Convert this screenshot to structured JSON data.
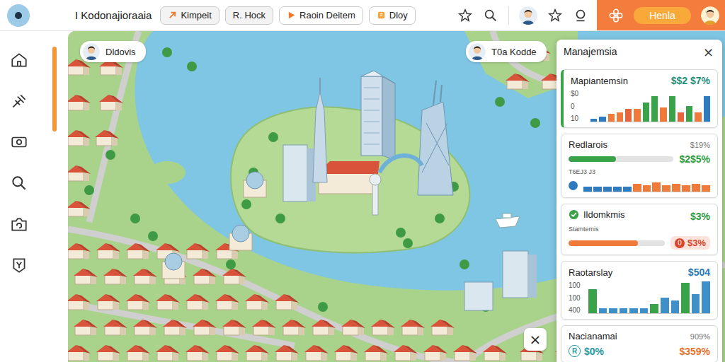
{
  "app": {
    "title": "I Kodonajioraaia"
  },
  "toolbar": {
    "buttons": [
      {
        "label": "Kimpeit",
        "kind": "arrow"
      },
      {
        "label": "R. Hock",
        "kind": "plain"
      },
      {
        "label": "Raoin Deitem",
        "kind": "play"
      },
      {
        "label": "Dloy",
        "kind": "doc"
      }
    ]
  },
  "account": {
    "action": "Henla"
  },
  "map": {
    "labels": [
      {
        "name": "Dldovis"
      },
      {
        "name": "T0a Kodde"
      }
    ],
    "close": "×"
  },
  "panel": {
    "title": "Manajemsia",
    "close": "×",
    "cards": [
      {
        "kind": "chart",
        "title": "Mapiantemsin",
        "value": "$$2 $7%",
        "ticks": [
          "$0",
          "0",
          "10"
        ],
        "max": 10,
        "bars": [
          {
            "value": 1,
            "color": "#2e7bbf"
          },
          {
            "value": 1.5,
            "color": "#2e7bbf"
          },
          {
            "value": 2.5,
            "color": "#f07a3a"
          },
          {
            "value": 3,
            "color": "#f07a3a"
          },
          {
            "value": 4,
            "color": "#e8643a"
          },
          {
            "value": 4,
            "color": "#f07a3a"
          },
          {
            "value": 6,
            "color": "#3aa34a"
          },
          {
            "value": 8,
            "color": "#3aa34a"
          },
          {
            "value": 4.5,
            "color": "#f07a3a"
          },
          {
            "value": 8,
            "color": "#3aa34a"
          },
          {
            "value": 3,
            "color": "#e8643a"
          },
          {
            "value": 5,
            "color": "#3aa34a"
          },
          {
            "value": 3,
            "color": "#f07a3a"
          },
          {
            "value": 8,
            "color": "#2e7bbf"
          }
        ]
      },
      {
        "kind": "progress-chart",
        "title": "Redlarois",
        "note": "$19%",
        "value": "$2$5%",
        "level": 0.45,
        "caption": "T6EJ3 J3",
        "max": 10,
        "bars": [
          {
            "value": 4,
            "color": "#2e7bbf"
          },
          {
            "value": 4,
            "color": "#2e7bbf"
          },
          {
            "value": 4,
            "color": "#2e7bbf"
          },
          {
            "value": 4,
            "color": "#2e7bbf"
          },
          {
            "value": 4,
            "color": "#2e7bbf"
          },
          {
            "value": 6,
            "color": "#f07a3a"
          },
          {
            "value": 5,
            "color": "#f07a3a"
          },
          {
            "value": 7,
            "color": "#f07a3a"
          },
          {
            "value": 5,
            "color": "#f07a3a"
          },
          {
            "value": 6,
            "color": "#f07a3a"
          },
          {
            "value": 5,
            "color": "#f07a3a"
          },
          {
            "value": 6,
            "color": "#f07a3a"
          },
          {
            "value": 5,
            "color": "#f07a3a"
          }
        ]
      },
      {
        "kind": "status",
        "title": "Ildomkmis",
        "value": "$3%",
        "sub_title": "Stamtemis",
        "level": 0.72,
        "badge": "0",
        "sub_value": "$3%"
      },
      {
        "kind": "chart",
        "title": "Raotarslay",
        "value": "$504",
        "ticks": [
          "100",
          "100",
          "400"
        ],
        "max": 400,
        "bars": [
          {
            "value": 300,
            "color": "#3aa34a"
          },
          {
            "value": 60,
            "color": "#3f8fc9"
          },
          {
            "value": 60,
            "color": "#3f8fc9"
          },
          {
            "value": 60,
            "color": "#3f8fc9"
          },
          {
            "value": 60,
            "color": "#3f8fc9"
          },
          {
            "value": 60,
            "color": "#3f8fc9"
          },
          {
            "value": 120,
            "color": "#3aa34a"
          },
          {
            "value": 200,
            "color": "#3f8fc9"
          },
          {
            "value": 160,
            "color": "#3f8fc9"
          },
          {
            "value": 380,
            "color": "#3aa34a"
          },
          {
            "value": 240,
            "color": "#3f8fc9"
          },
          {
            "value": 400,
            "color": "#3f8fc9"
          }
        ]
      },
      {
        "kind": "summary",
        "title": "Nacianamai",
        "note": "909%",
        "badge": "R",
        "value": "$0%",
        "sub_value": "$359%"
      }
    ]
  }
}
